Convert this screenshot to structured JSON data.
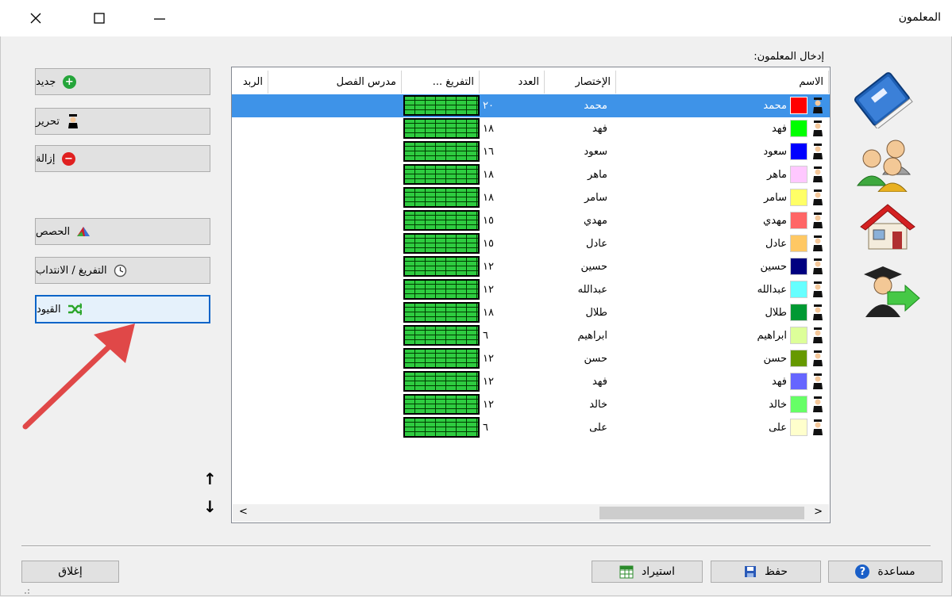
{
  "window": {
    "title": "المعلمون",
    "controls": [
      "close",
      "maximize",
      "minimize"
    ]
  },
  "section_label": "إدخال المعلمون:",
  "left_buttons": {
    "new": "جديد",
    "edit": "تحرير",
    "delete": "إزالة",
    "lessons": "الحصص",
    "availability": "التفريغ / الانتداب",
    "constraints": "القيود"
  },
  "columns": {
    "name": "الاسم",
    "short": "الإختصار",
    "count": "العدد",
    "availability": "التفريغ ...",
    "class_teacher": "مدرس الفصل",
    "rab": "الربد"
  },
  "rows": [
    {
      "name": "محمد",
      "short": "محمد",
      "count": "٢٠",
      "color": "#ff0000"
    },
    {
      "name": "فهد",
      "short": "فهد",
      "count": "١٨",
      "color": "#00ff00"
    },
    {
      "name": "سعود",
      "short": "سعود",
      "count": "١٦",
      "color": "#0000ff"
    },
    {
      "name": "ماهر",
      "short": "ماهر",
      "count": "١٨",
      "color": "#ffc8ff"
    },
    {
      "name": "سامر",
      "short": "سامر",
      "count": "١٨",
      "color": "#ffff66"
    },
    {
      "name": "مهدي",
      "short": "مهدي",
      "count": "١٥",
      "color": "#ff6666"
    },
    {
      "name": "عادل",
      "short": "عادل",
      "count": "١٥",
      "color": "#ffc864"
    },
    {
      "name": "حسين",
      "short": "حسين",
      "count": "١٢",
      "color": "#000080"
    },
    {
      "name": "عبدالله",
      "short": "عبدالله",
      "count": "١٢",
      "color": "#66ffff"
    },
    {
      "name": "طلال",
      "short": "طلال",
      "count": "١٨",
      "color": "#009933"
    },
    {
      "name": "ابراهيم",
      "short": "ابراهيم",
      "count": "٦",
      "color": "#ddff99"
    },
    {
      "name": "حسن",
      "short": "حسن",
      "count": "١٢",
      "color": "#669900"
    },
    {
      "name": "فهد",
      "short": "فهد",
      "count": "١٢",
      "color": "#6666ff"
    },
    {
      "name": "خالد",
      "short": "خالد",
      "count": "١٢",
      "color": "#66ff66"
    },
    {
      "name": "على",
      "short": "على",
      "count": "٦",
      "color": "#ffffcc"
    }
  ],
  "selected_row": 0,
  "side_icons": [
    "book-icon",
    "users-icon",
    "house-icon",
    "graduate-exit-icon"
  ],
  "bottom_buttons": {
    "help": "مساعدة",
    "save": "حفظ",
    "import": "استيراد",
    "close": "إغلاق"
  },
  "accent": "#3e93e8"
}
